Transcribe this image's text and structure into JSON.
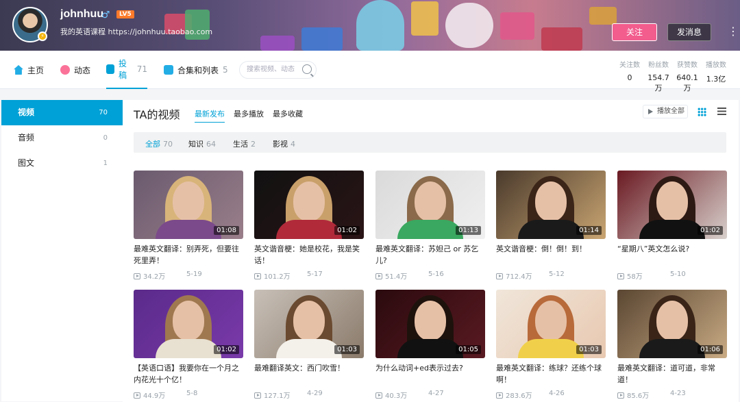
{
  "header": {
    "username": "johnhuu",
    "gender_symbol": "♂",
    "level": "LV5",
    "sign": "我的英语课程 https://johnhuu.taobao.com",
    "follow_label": "关注",
    "message_label": "发消息",
    "more_label": "⋮",
    "verify_badge": "⚡"
  },
  "nav": {
    "tabs": [
      {
        "label": "主页",
        "count": "",
        "icon": "home-icon"
      },
      {
        "label": "动态",
        "count": "",
        "icon": "activity-icon"
      },
      {
        "label": "投稿",
        "count": "71",
        "icon": "upload-icon"
      },
      {
        "label": "合集和列表",
        "count": "5",
        "icon": "playlist-icon"
      }
    ],
    "search_placeholder": "搜索视频、动态"
  },
  "stats": [
    {
      "label": "关注数",
      "value": "0"
    },
    {
      "label": "粉丝数",
      "value": "154.7万"
    },
    {
      "label": "获赞数",
      "value": "640.1万"
    },
    {
      "label": "播放数",
      "value": "1.3亿"
    }
  ],
  "sidebar": {
    "items": [
      {
        "label": "视频",
        "count": "70"
      },
      {
        "label": "音频",
        "count": "0"
      },
      {
        "label": "图文",
        "count": "1"
      }
    ]
  },
  "main": {
    "title": "TA的视频",
    "sort_tabs": [
      "最新发布",
      "最多播放",
      "最多收藏"
    ],
    "play_all": "播放全部",
    "filters": [
      {
        "label": "全部",
        "count": "70"
      },
      {
        "label": "知识",
        "count": "64"
      },
      {
        "label": "生活",
        "count": "2"
      },
      {
        "label": "影视",
        "count": "4"
      }
    ]
  },
  "colors": {
    "accent": "#00a1d6",
    "follow": "#f25d8e"
  },
  "videos": [
    {
      "title": "最难英文翻译：别弄死，但要往死里弄！",
      "duration": "01:08",
      "views": "34.2万",
      "date": "5-19"
    },
    {
      "title": "英文谐音梗：她是校花，我是笑话！",
      "duration": "01:02",
      "views": "101.2万",
      "date": "5-17"
    },
    {
      "title": "最难英文翻译：苏妲己 or 苏乞儿?",
      "duration": "01:13",
      "views": "51.4万",
      "date": "5-16"
    },
    {
      "title": "英文谐音梗：倒！倒！到！",
      "duration": "01:14",
      "views": "712.4万",
      "date": "5-12"
    },
    {
      "title": "“星期八”英文怎么说?",
      "duration": "01:02",
      "views": "58万",
      "date": "5-10"
    },
    {
      "title": "【英语口语】我要你在一个月之内花光十个亿！",
      "duration": "01:02",
      "views": "44.9万",
      "date": "5-8"
    },
    {
      "title": "最难翻译英文：西门吹雪！",
      "duration": "01:03",
      "views": "127.1万",
      "date": "4-29"
    },
    {
      "title": "为什么动词+ed表示过去?",
      "duration": "01:05",
      "views": "40.3万",
      "date": "4-27"
    },
    {
      "title": "最难英文翻译：练球？还练个球啊！",
      "duration": "01:03",
      "views": "283.6万",
      "date": "4-26"
    },
    {
      "title": "最难英文翻译：道可道，非常道！",
      "duration": "01:06",
      "views": "85.6万",
      "date": "4-23"
    }
  ]
}
